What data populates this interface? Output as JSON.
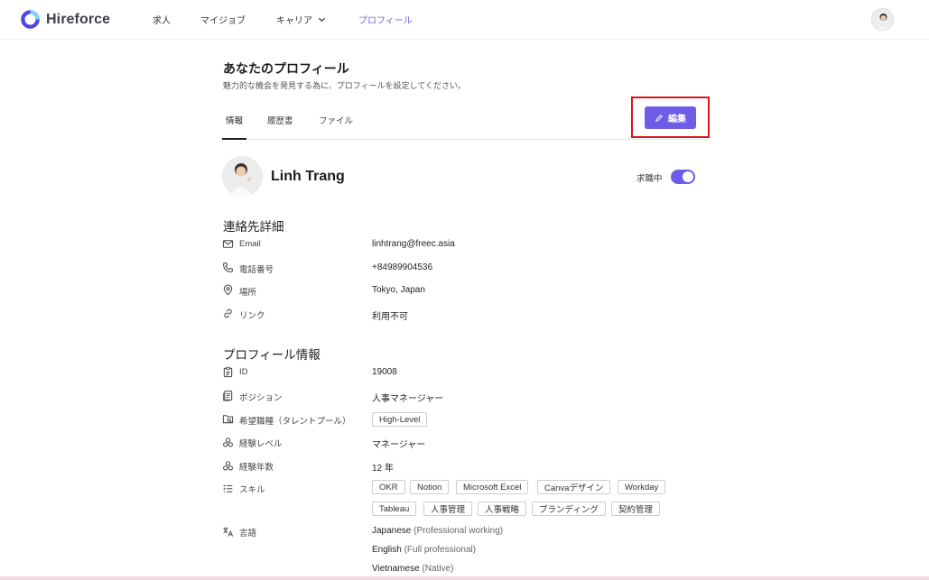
{
  "app": {
    "name": "Hireforce",
    "brand_color": "#6c5ce7"
  },
  "nav": {
    "items": [
      {
        "label": "求人"
      },
      {
        "label": "マイジョブ"
      },
      {
        "label": "キャリア"
      },
      {
        "label": "プロフィール"
      }
    ]
  },
  "page": {
    "title": "あなたのプロフィール",
    "subtitle": "魅力的な機会を発見する為に、プロフィールを設定してください。"
  },
  "tabs": [
    {
      "label": "情報",
      "active": true
    },
    {
      "label": "履歴書"
    },
    {
      "label": "ファイル"
    }
  ],
  "edit_button": {
    "label": "編集"
  },
  "profile": {
    "name": "Linh Trang",
    "job_status_label": "求職中",
    "job_status_on": true
  },
  "contact": {
    "title": "連絡先詳細",
    "rows": [
      {
        "icon": "mail-icon",
        "label": "Email",
        "value": "linhtrang@freec.asia"
      },
      {
        "icon": "phone-icon",
        "label": "電話番号",
        "value": "+84989904536"
      },
      {
        "icon": "location-pin-icon",
        "label": "場所",
        "value": "Tokyo, Japan"
      },
      {
        "icon": "link-icon",
        "label": "リンク",
        "value": "利用不可"
      }
    ]
  },
  "profile_info": {
    "title": "プロフィール情報",
    "id": {
      "label": "ID",
      "value": "19008"
    },
    "position": {
      "label": "ポジション",
      "value": "人事マネージャー"
    },
    "desired_type": {
      "label": "希望職種（タレントプール）",
      "tag": "High-Level"
    },
    "experience_level": {
      "label": "経験レベル",
      "value": "マネージャー"
    },
    "experience_years": {
      "label": "経験年数",
      "value": "12 年"
    },
    "skills": {
      "label": "スキル",
      "row1": [
        "OKR",
        "Notion",
        "Microsoft Excel",
        "Canvaデザイン",
        "Workday"
      ],
      "row2": [
        "Tableau",
        "人事管理",
        "人事戦略",
        "ブランディング",
        "契約管理"
      ]
    },
    "languages": {
      "label": "言語",
      "items": [
        {
          "name": "Japanese",
          "level": "(Professional working)"
        },
        {
          "name": "English",
          "level": "(Full professional)"
        },
        {
          "name": "Vietnamese",
          "level": "(Native)"
        }
      ]
    }
  }
}
